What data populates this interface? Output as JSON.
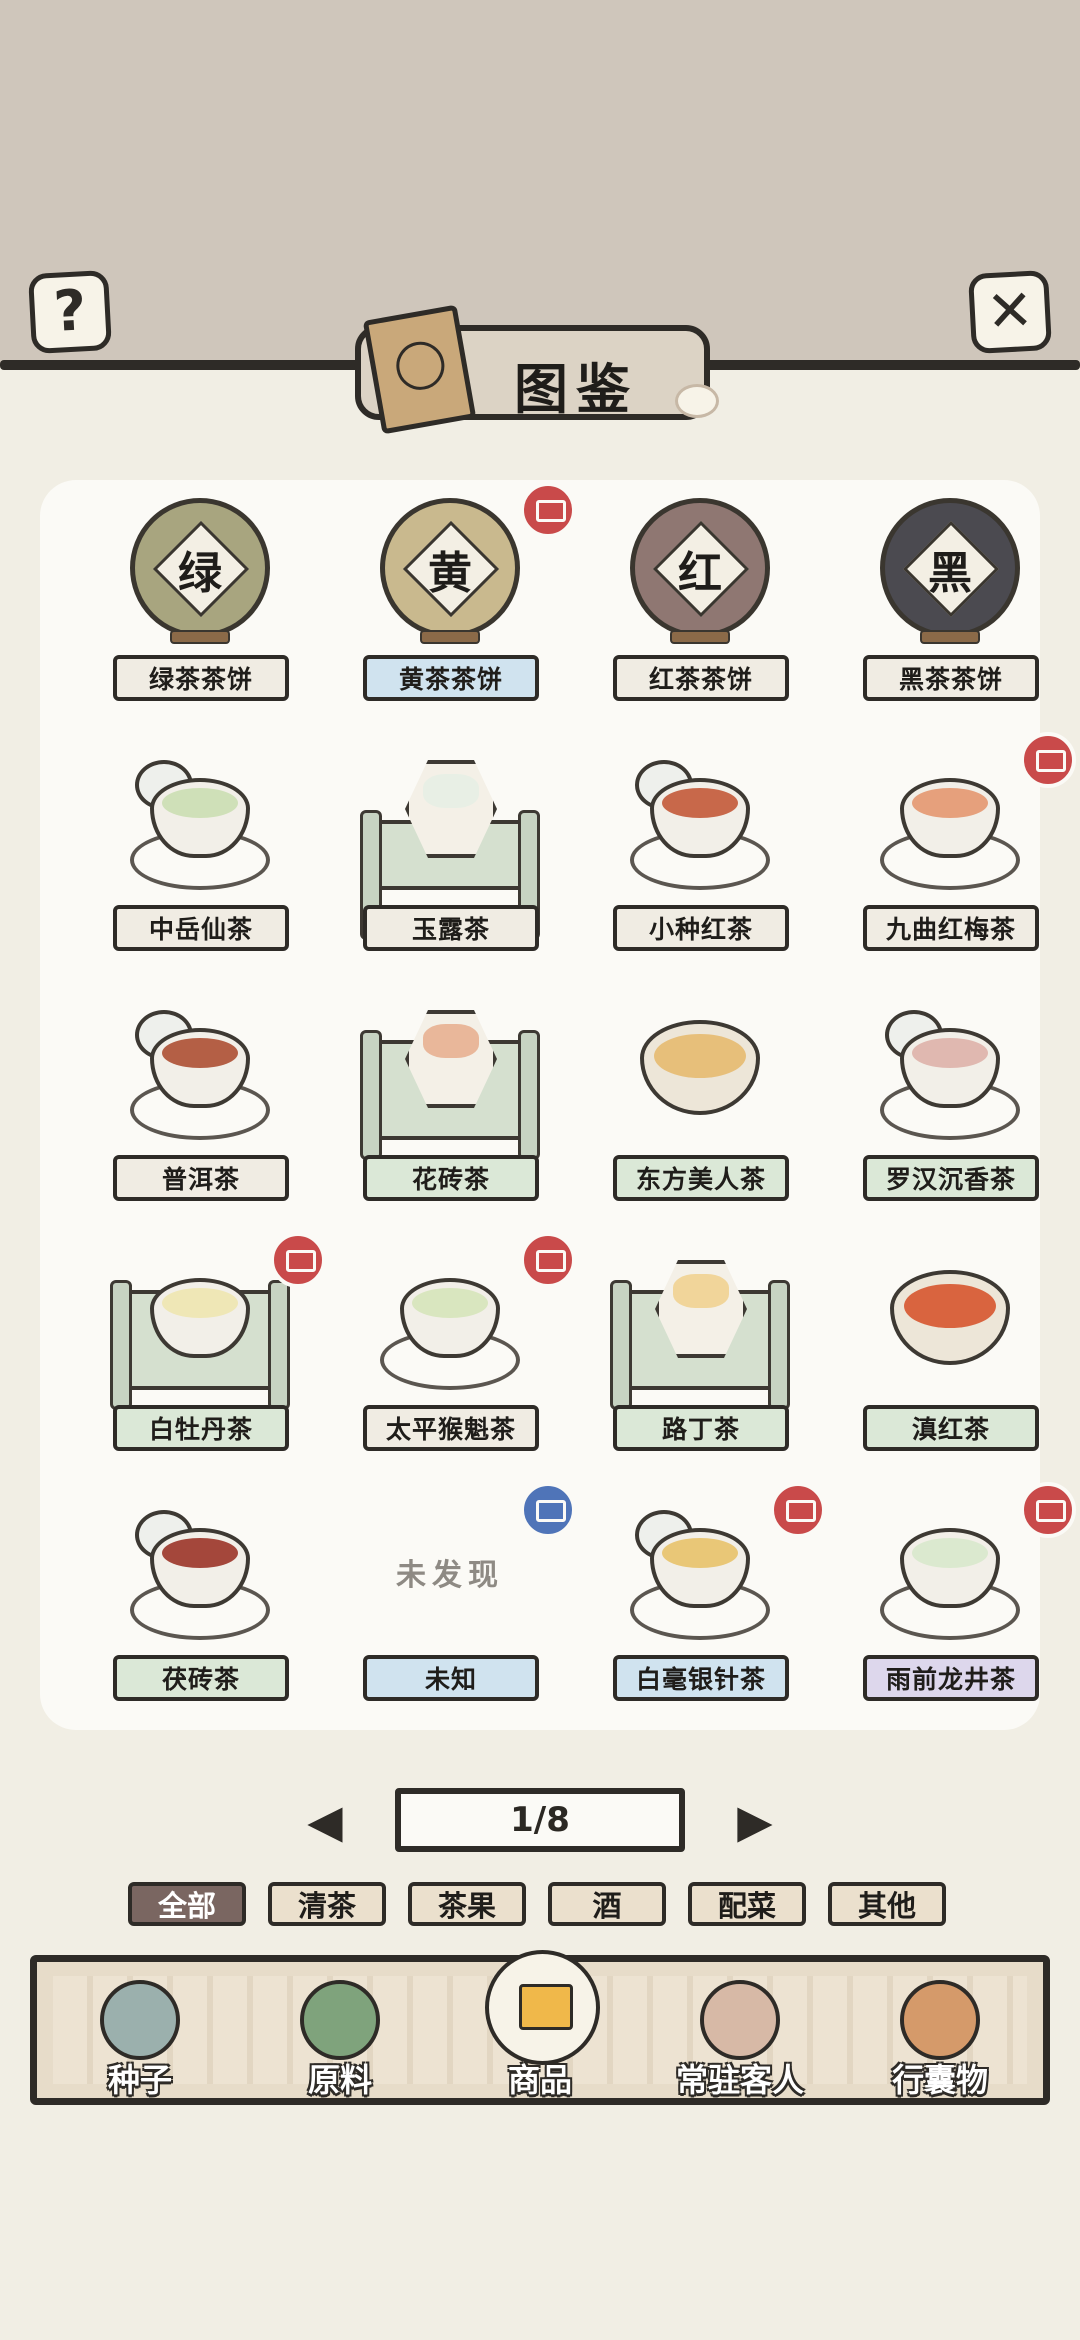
{
  "header": {
    "title": "图鉴",
    "help_icon": "question-mark-icon",
    "close_icon": "close-icon"
  },
  "grid": {
    "items": [
      {
        "name": "绿茶茶饼",
        "art": "cake",
        "glyph": "绿",
        "color": "#a8a57f",
        "label_style": "plain",
        "stamp": "none"
      },
      {
        "name": "黄茶茶饼",
        "art": "cake",
        "glyph": "黄",
        "color": "#c9b98e",
        "label_style": "blue",
        "stamp": "red"
      },
      {
        "name": "红茶茶饼",
        "art": "cake",
        "glyph": "红",
        "color": "#8f7772",
        "label_style": "plain",
        "stamp": "none"
      },
      {
        "name": "黑茶茶饼",
        "art": "cake",
        "glyph": "黑",
        "color": "#4b4a50",
        "label_style": "plain",
        "stamp": "none"
      },
      {
        "name": "中岳仙茶",
        "art": "cup-lid",
        "liquid": "#cfe0b8",
        "label_style": "plain",
        "stamp": "none"
      },
      {
        "name": "玉露茶",
        "art": "hex",
        "liquid": "#e8efe5",
        "label_style": "plain",
        "stamp": "none"
      },
      {
        "name": "小种红茶",
        "art": "cup-lid",
        "liquid": "#c8684a",
        "label_style": "plain",
        "stamp": "none"
      },
      {
        "name": "九曲红梅茶",
        "art": "cup",
        "liquid": "#e6a07c",
        "label_style": "plain",
        "stamp": "red"
      },
      {
        "name": "普洱茶",
        "art": "cup-lid",
        "liquid": "#b45f45",
        "label_style": "plain",
        "stamp": "none"
      },
      {
        "name": "花砖茶",
        "art": "hex-frame",
        "liquid": "#e9b79a",
        "label_style": "green",
        "stamp": "none"
      },
      {
        "name": "东方美人茶",
        "art": "bowl",
        "liquid": "#e7bf7a",
        "label_style": "green",
        "stamp": "none"
      },
      {
        "name": "罗汉沉香茶",
        "art": "cup-lid",
        "liquid": "#e0b8b0",
        "label_style": "green",
        "stamp": "none"
      },
      {
        "name": "白牡丹茶",
        "art": "cup-frame",
        "liquid": "#efe7b6",
        "label_style": "green",
        "stamp": "red"
      },
      {
        "name": "太平猴魁茶",
        "art": "cup",
        "liquid": "#d9e6bf",
        "label_style": "plain",
        "stamp": "red"
      },
      {
        "name": "路丁茶",
        "art": "hex-frame",
        "liquid": "#f1d59a",
        "label_style": "green",
        "stamp": "none"
      },
      {
        "name": "滇红茶",
        "art": "bowl",
        "liquid": "#d9643f",
        "label_style": "green",
        "stamp": "none"
      },
      {
        "name": "茯砖茶",
        "art": "cup-lid",
        "liquid": "#a4473b",
        "label_style": "green",
        "stamp": "none"
      },
      {
        "name": "未知",
        "art": "unknown",
        "unknown_text": "未发现",
        "label_style": "blue",
        "stamp": "blue"
      },
      {
        "name": "白毫银针茶",
        "art": "cup-lid",
        "liquid": "#e9c777",
        "label_style": "blue",
        "stamp": "red"
      },
      {
        "name": "雨前龙井茶",
        "art": "cup",
        "liquid": "#dbe9cf",
        "label_style": "purple",
        "stamp": "red"
      }
    ]
  },
  "pager": {
    "text": "1/8",
    "prev_icon": "left-arrow-icon",
    "next_icon": "right-arrow-icon"
  },
  "filters": {
    "tabs": [
      "全部",
      "清茶",
      "茶果",
      "酒",
      "配菜",
      "其他"
    ],
    "active": "全部"
  },
  "bottom_nav": {
    "items": [
      {
        "label": "种子",
        "icon": "seed-jar-icon",
        "color": "#9bb0ad"
      },
      {
        "label": "原料",
        "icon": "tea-leaf-icon",
        "color": "#7fa37c"
      },
      {
        "label": "商品",
        "icon": "goods-box-icon",
        "color": "#f7f3e8"
      },
      {
        "label": "常驻客人",
        "icon": "guest-girl-icon",
        "color": "#d7b9a6"
      },
      {
        "label": "行囊物",
        "icon": "bag-clothes-icon",
        "color": "#d59a6a"
      }
    ],
    "active": "商品"
  }
}
